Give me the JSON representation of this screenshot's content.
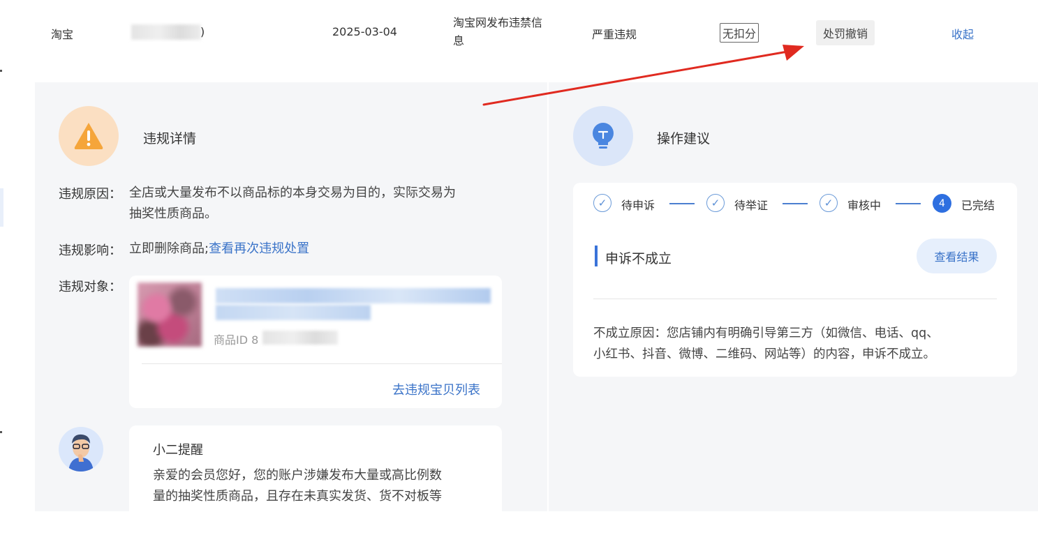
{
  "top_row": {
    "platform": "淘宝",
    "id_suffix": ")",
    "date": "2025-03-04",
    "violation_type": [
      "淘宝网发布违禁信",
      "息"
    ],
    "severity": "严重违规",
    "deduction_tag": "无扣分",
    "penalty_status": "处罚撤销",
    "collapse_link": "收起"
  },
  "violation": {
    "title": "违规详情",
    "reason_label": "违规原因：",
    "reason_lines": [
      "全店或大量发布不以商品标的本身交易为目的，实际交易为",
      "抽奖性质商品。"
    ],
    "impact_label": "违规影响：",
    "impact_text": "立即删除商品;",
    "impact_link": "查看再次违规处置",
    "object_label": "违规对象：",
    "product_id_prefix": "商品ID 8",
    "list_link": "去违规宝贝列表"
  },
  "reminder": {
    "title": "小二提醒",
    "lines": [
      "亲爱的会员您好，您的账户涉嫌发布大量或高比例数",
      "量的抽奖性质商品，且存在未真实发货、货不对板等"
    ]
  },
  "advice": {
    "title": "操作建议",
    "steps": [
      {
        "label": "待申诉"
      },
      {
        "label": "待举证"
      },
      {
        "label": "审核中"
      },
      {
        "label": "已完结",
        "number": "4"
      }
    ],
    "status": "申诉不成立",
    "view_result": "查看结果",
    "reason_lines": [
      "不成立原因：您店铺内有明确引导第三方（如微信、电话、qq、",
      "小红书、抖音、微博、二维码、网站等）的内容，申诉不成立。"
    ]
  },
  "colors": {
    "accent": "#3a73c8",
    "warning": "#f5a53a",
    "panel_bg": "#f5f6f8",
    "annotation_arrow": "#e02a20"
  }
}
